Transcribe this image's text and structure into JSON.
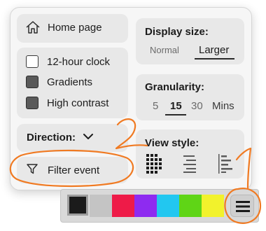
{
  "menu": {
    "home": {
      "label": "Home page",
      "icon": "home-icon"
    },
    "options": [
      {
        "label": "12-hour clock",
        "checked": false
      },
      {
        "label": "Gradients",
        "checked": true
      },
      {
        "label": "High contrast",
        "checked": true
      }
    ],
    "direction": {
      "label": "Direction:",
      "icon": "chevron-down-icon"
    },
    "filter": {
      "label": "Filter event",
      "icon": "filter-icon"
    }
  },
  "display_size": {
    "title": "Display size:",
    "options": [
      "Normal",
      "Larger"
    ],
    "selected": "Larger"
  },
  "granularity": {
    "title": "Granularity:",
    "options": [
      "5",
      "15",
      "30"
    ],
    "selected": "15",
    "unit": "Mins"
  },
  "view_style": {
    "title": "View style:",
    "icons": [
      "grid-view-icon",
      "list-view-icon",
      "timeline-view-icon"
    ]
  },
  "color_bar": {
    "selected": "#1b1b1b",
    "swatches": [
      "#c4c4c4",
      "#ee1b48",
      "#8e2bf0",
      "#22c7f0",
      "#5fd516",
      "#f2f22c"
    ],
    "menu_icon": "hamburger-menu-icon"
  },
  "annotations": {
    "color": "#f07a22",
    "numbers": [
      "1",
      "2"
    ]
  }
}
